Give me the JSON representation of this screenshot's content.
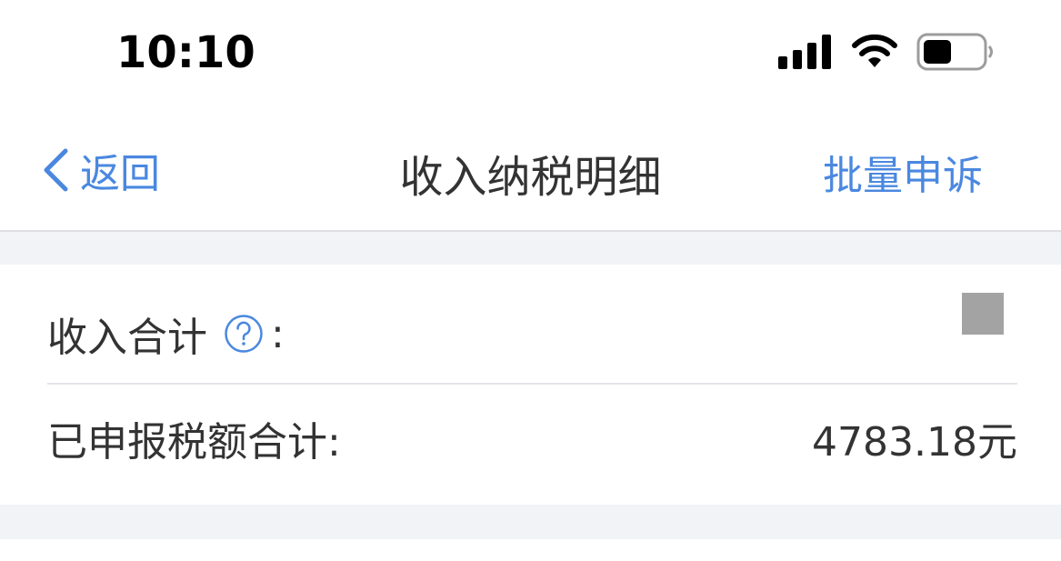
{
  "status_bar": {
    "time": "10:10",
    "icons": [
      "signal-icon",
      "wifi-icon",
      "battery-icon"
    ]
  },
  "nav": {
    "back_label": "返回",
    "title": "收入纳税明细",
    "action_label": "批量申诉"
  },
  "summary": {
    "income_label": "收入合计",
    "income_colon": ":",
    "income_value": "",
    "tax_label": "已申报税额合计:",
    "tax_value": "4783.18元"
  },
  "colors": {
    "accent": "#4a88e0",
    "text": "#333333",
    "background_band": "#f2f3f7",
    "placeholder": "#a3a3a3"
  }
}
